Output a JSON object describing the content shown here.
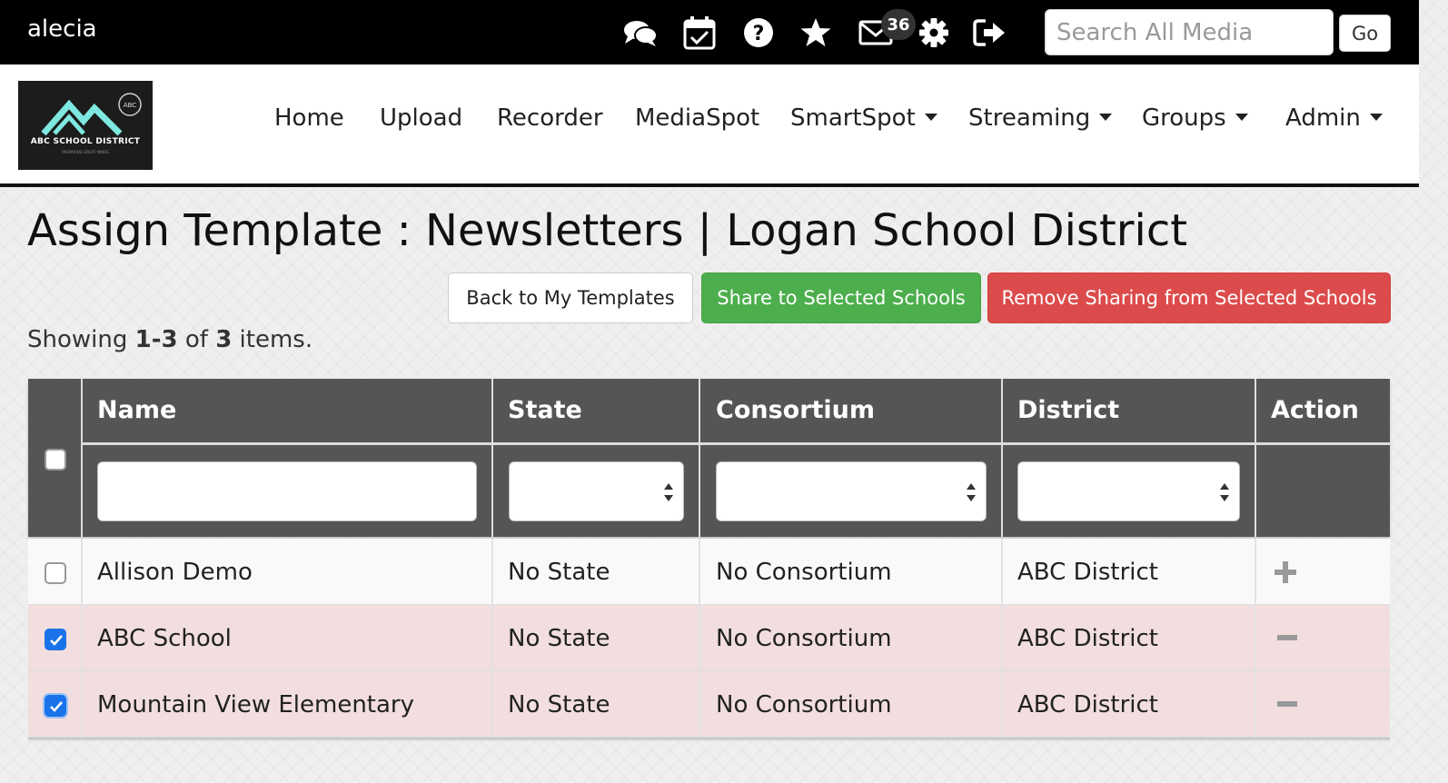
{
  "topbar": {
    "username": "alecia",
    "icons": [
      "chat-icon",
      "calendar-check-icon",
      "help-icon",
      "star-icon",
      "mail-icon",
      "gear-icon",
      "sign-out-icon"
    ],
    "mail_count": "36",
    "search_placeholder": "Search All Media",
    "go_label": "Go"
  },
  "logo": {
    "badge": "ABC",
    "name": "ABC SCHOOL DISTRICT",
    "tagline": "PREPARING GREAT MINDS"
  },
  "nav": {
    "items": [
      {
        "label": "Home",
        "dropdown": false
      },
      {
        "label": "Upload",
        "dropdown": false
      },
      {
        "label": "Recorder",
        "dropdown": false
      },
      {
        "label": "MediaSpot",
        "dropdown": false
      },
      {
        "label": "SmartSpot",
        "dropdown": true
      },
      {
        "label": "Streaming",
        "dropdown": true
      },
      {
        "label": "Groups",
        "dropdown": true
      },
      {
        "label": "Admin",
        "dropdown": true
      }
    ]
  },
  "page": {
    "title": "Assign Template : Newsletters | Logan School District",
    "buttons": {
      "back": "Back to My Templates",
      "share": "Share to Selected Schools",
      "remove": "Remove Sharing from Selected Schools"
    },
    "summary": {
      "prefix": "Showing ",
      "range": "1-3",
      "of": " of ",
      "total": "3",
      "suffix": " items."
    }
  },
  "colors": {
    "share": "#4cae4c",
    "remove": "#dc4b4b",
    "header": "#555555",
    "selected_row": "#f2dede",
    "checkbox": "#1a73e8"
  },
  "table": {
    "columns": [
      "Name",
      "State",
      "Consortium",
      "District",
      "Action"
    ],
    "rows": [
      {
        "name": "Allison Demo",
        "state": "No State",
        "consortium": "No Consortium",
        "district": "ABC District",
        "checked": false,
        "action": "plus-icon"
      },
      {
        "name": "ABC School",
        "state": "No State",
        "consortium": "No Consortium",
        "district": "ABC District",
        "checked": true,
        "action": "minus-icon"
      },
      {
        "name": "Mountain View Elementary",
        "state": "No State",
        "consortium": "No Consortium",
        "district": "ABC District",
        "checked": true,
        "action": "minus-icon"
      }
    ]
  }
}
